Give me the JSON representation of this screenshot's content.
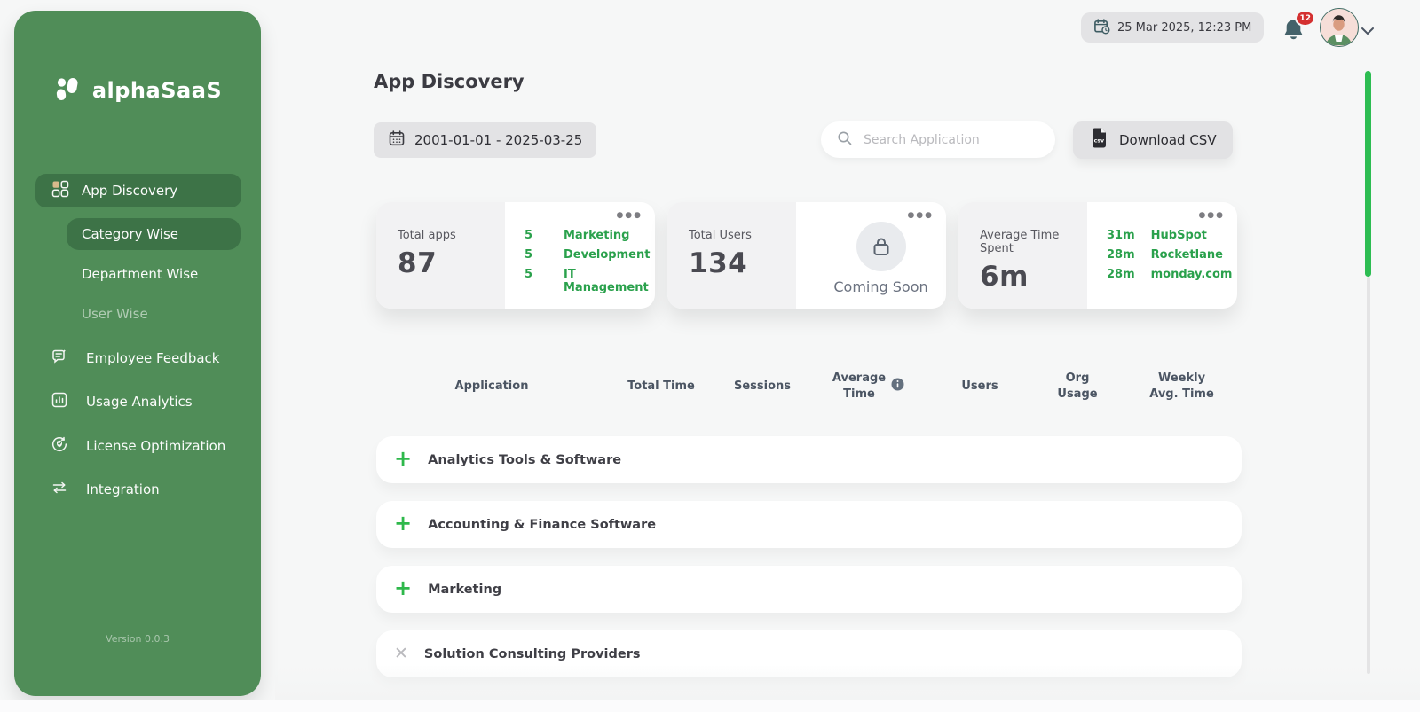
{
  "brand": {
    "name": "alphaSaaS"
  },
  "sidebar": {
    "version": "Version 0.0.3",
    "items": [
      {
        "label": "App Discovery",
        "active": true
      },
      {
        "label": "Category Wise",
        "active": true
      },
      {
        "label": "Department Wise",
        "active": false
      },
      {
        "label": "User Wise",
        "active": false
      },
      {
        "label": "Employee Feedback",
        "active": false
      },
      {
        "label": "Usage Analytics",
        "active": false
      },
      {
        "label": "License Optimization",
        "active": false
      },
      {
        "label": "Integration",
        "active": false
      }
    ]
  },
  "header": {
    "datetime": "25 Mar 2025, 12:23 PM",
    "notification_count": "12"
  },
  "page": {
    "title": "App Discovery",
    "date_range": "2001-01-01 - 2025-03-25",
    "search_placeholder": "Search Application",
    "download_csv_label": "Download CSV"
  },
  "cards": [
    {
      "label": "Total apps",
      "value": "87",
      "items": [
        {
          "value": "5",
          "name": "Marketing"
        },
        {
          "value": "5",
          "name": "Development"
        },
        {
          "value": "5",
          "name": "IT Management"
        }
      ]
    },
    {
      "label": "Total Users",
      "value": "134",
      "coming_soon": "Coming Soon"
    },
    {
      "label": "Average Time Spent",
      "value": "6m",
      "items": [
        {
          "value": "31m",
          "name": "HubSpot"
        },
        {
          "value": "28m",
          "name": "Rocketlane"
        },
        {
          "value": "28m",
          "name": "monday.com"
        }
      ]
    }
  ],
  "table": {
    "columns": {
      "application": "Application",
      "total_time": "Total Time",
      "sessions": "Sessions",
      "average_time": "Average Time",
      "users": "Users",
      "org_usage": "Org Usage",
      "weekly_avg_time": "Weekly Avg. Time"
    },
    "rows": [
      {
        "name": "Analytics Tools & Software",
        "state": "collapsed"
      },
      {
        "name": "Accounting & Finance Software",
        "state": "collapsed"
      },
      {
        "name": "Marketing",
        "state": "collapsed"
      },
      {
        "name": "Solution Consulting Providers",
        "state": "expanded"
      }
    ]
  },
  "colors": {
    "sidebar_green": "#508d58",
    "active_green": "#3d7347",
    "accent_green": "#2aa14c",
    "plus_green": "#2eb84b",
    "badge_red": "#d43030",
    "scrollbar_green": "#2dbd52"
  }
}
